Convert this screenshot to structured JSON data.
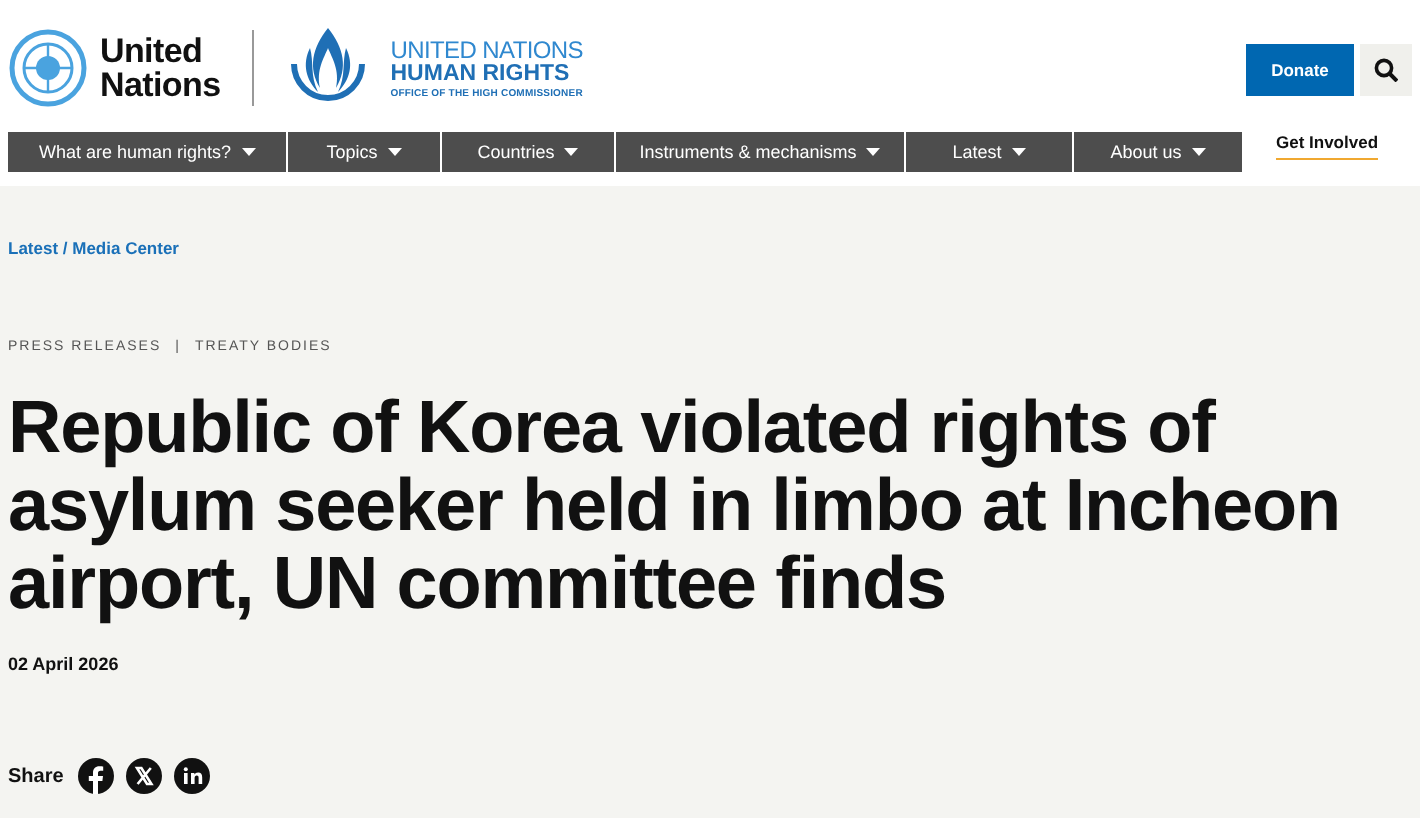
{
  "header": {
    "un_logo_text": [
      "United",
      "Nations"
    ],
    "ohchr_logo_text": [
      "UNITED NATIONS",
      "HUMAN RIGHTS",
      "OFFICE OF THE HIGH COMMISSIONER"
    ],
    "donate_button": "Donate"
  },
  "nav": [
    {
      "label": "What are human rights?",
      "kind": "menu"
    },
    {
      "label": "Topics",
      "kind": "menu"
    },
    {
      "label": "Countries",
      "kind": "menu"
    },
    {
      "label": "Instruments & mechanisms",
      "kind": "menu"
    },
    {
      "label": "Latest",
      "kind": "menu"
    },
    {
      "label": "About us",
      "kind": "menu"
    },
    {
      "label": "Get Involved",
      "kind": "highlight"
    }
  ],
  "breadcrumb": "Latest / Media Center",
  "tags": [
    "PRESS RELEASES",
    "TREATY BODIES"
  ],
  "tag_separator": "|",
  "title": "Republic of Korea violated rights of asylum seeker held in limbo at Incheon airport, UN committee finds",
  "date": "02 April 2026",
  "share": {
    "label": "Share",
    "networks": [
      {
        "kind": "facebook"
      },
      {
        "kind": "x"
      },
      {
        "kind": "linkedin"
      }
    ]
  }
}
